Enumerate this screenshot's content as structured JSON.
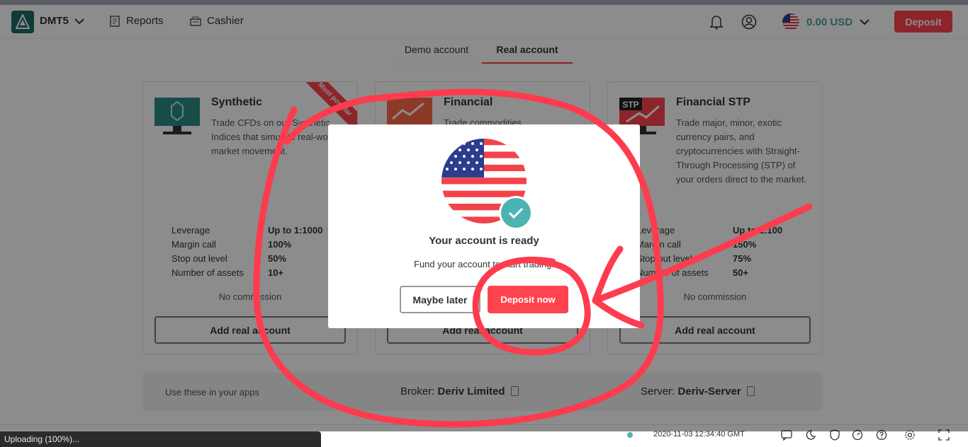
{
  "header": {
    "account_name": "DMT5",
    "nav_reports": "Reports",
    "nav_cashier": "Cashier",
    "balance": "0.00 USD",
    "deposit_label": "Deposit"
  },
  "tabs": [
    {
      "label": "Demo account",
      "active": false
    },
    {
      "label": "Real account",
      "active": true
    }
  ],
  "cards": [
    {
      "title": "Synthetic",
      "ribbon": "Most popular",
      "description": "Trade CFDs on our Synthetic Indices that simulate real-world market movement.",
      "specs": [
        {
          "key": "Leverage",
          "value": "Up to 1:1000"
        },
        {
          "key": "Margin call",
          "value": "100%"
        },
        {
          "key": "Stop out level",
          "value": "50%"
        },
        {
          "key": "Number of assets",
          "value": "10+"
        }
      ],
      "commission": "No commission",
      "button": "Add real account"
    },
    {
      "title": "Financial",
      "description": "Trade commodities",
      "specs": [],
      "commission": "",
      "button": "Add real account"
    },
    {
      "title": "Financial STP",
      "badge": "STP",
      "description": "Trade major, minor, exotic currency pairs, and cryptocurrencies with Straight-Through Processing (STP) of your orders direct to the market.",
      "specs": [
        {
          "key": "Leverage",
          "value": "Up to 1:100"
        },
        {
          "key": "Margin call",
          "value": "150%"
        },
        {
          "key": "Stop out level",
          "value": "75%"
        },
        {
          "key": "Number of assets",
          "value": "50+"
        }
      ],
      "commission": "No commission",
      "button": "Add real account"
    }
  ],
  "info_bar": {
    "label": "Use these in your apps",
    "broker_label": "Broker:",
    "broker_value": "Deriv Limited",
    "server_label": "Server:",
    "server_value": "Deriv-Server"
  },
  "footer": {
    "datetime": "2020-11-03 12:34:40 GMT",
    "uploading": "Uploading (100%)..."
  },
  "modal": {
    "title": "Your account is ready",
    "subtitle": "Fund your account to start trading.",
    "later_label": "Maybe later",
    "deposit_label": "Deposit now"
  },
  "colors": {
    "brand_red": "#ff444f",
    "teal": "#4bb4b3",
    "annotation_red": "#ff3b4e"
  },
  "icons": [
    "dmt5-logo-icon",
    "chevron-down-icon",
    "reports-icon",
    "cashier-icon",
    "bell-icon",
    "user-icon",
    "us-flag-icon",
    "check-icon",
    "copy-icon",
    "chat-icon",
    "theme-icon",
    "shield-icon",
    "gauge-icon",
    "help-icon",
    "settings-icon",
    "fullscreen-icon"
  ]
}
